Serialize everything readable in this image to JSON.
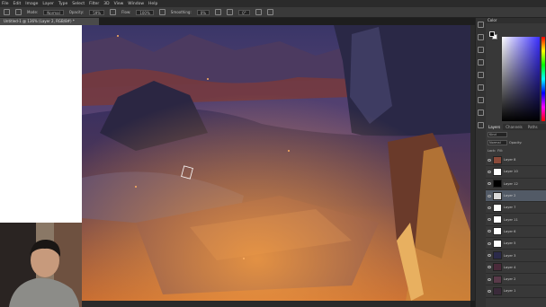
{
  "app": {
    "menu": [
      "File",
      "Edit",
      "Image",
      "Layer",
      "Type",
      "Select",
      "Filter",
      "3D",
      "View",
      "Window",
      "Help"
    ]
  },
  "options": {
    "mode_label": "Mode:",
    "mode_value": "Normal",
    "opacity_label": "Opacity:",
    "opacity_value": "59%",
    "flow_label": "Flow:",
    "flow_value": "100%",
    "smoothing_label": "Smoothing:",
    "smoothing_value": "0%",
    "angle_value": "0°"
  },
  "document": {
    "tab_title": "Untitled-1 @ 136% (Layer 2, RGB/8#) *"
  },
  "color_panel": {
    "title": "Color",
    "foreground": "#000000",
    "background": "#ffffff"
  },
  "layers_panel": {
    "tabs": [
      "Layers",
      "Channels",
      "Paths"
    ],
    "kind_label": "Kind",
    "blend_mode": "Normal",
    "opacity_label": "Opacity:",
    "lock_label": "Lock:",
    "fill_label": "Fill:",
    "layers": [
      {
        "name": "Layer 8",
        "thumb": "#8b4a3a"
      },
      {
        "name": "Layer 10",
        "thumb": "#ffffff"
      },
      {
        "name": "Layer 12",
        "thumb": "#000000"
      },
      {
        "name": "Layer 2",
        "thumb": "#d9d9d9",
        "selected": true
      },
      {
        "name": "Layer 7",
        "thumb": "#ffffff"
      },
      {
        "name": "Layer 11",
        "thumb": "#ffffff"
      },
      {
        "name": "Layer 6",
        "thumb": "#ffffff"
      },
      {
        "name": "Layer 5",
        "thumb": "#ffffff"
      },
      {
        "name": "Layer 3",
        "thumb": "#2b2a4a"
      },
      {
        "name": "Layer 4",
        "thumb": "#4a2a3a"
      },
      {
        "name": "Layer 2",
        "thumb": "#5a3a4a"
      },
      {
        "name": "Layer 1",
        "thumb": "#3a2a3a"
      }
    ]
  },
  "colors": {
    "sky": "#3c3768",
    "glow": "#e0772c",
    "stone_dark": "#2a2340",
    "selected_layer": "#525a66"
  }
}
